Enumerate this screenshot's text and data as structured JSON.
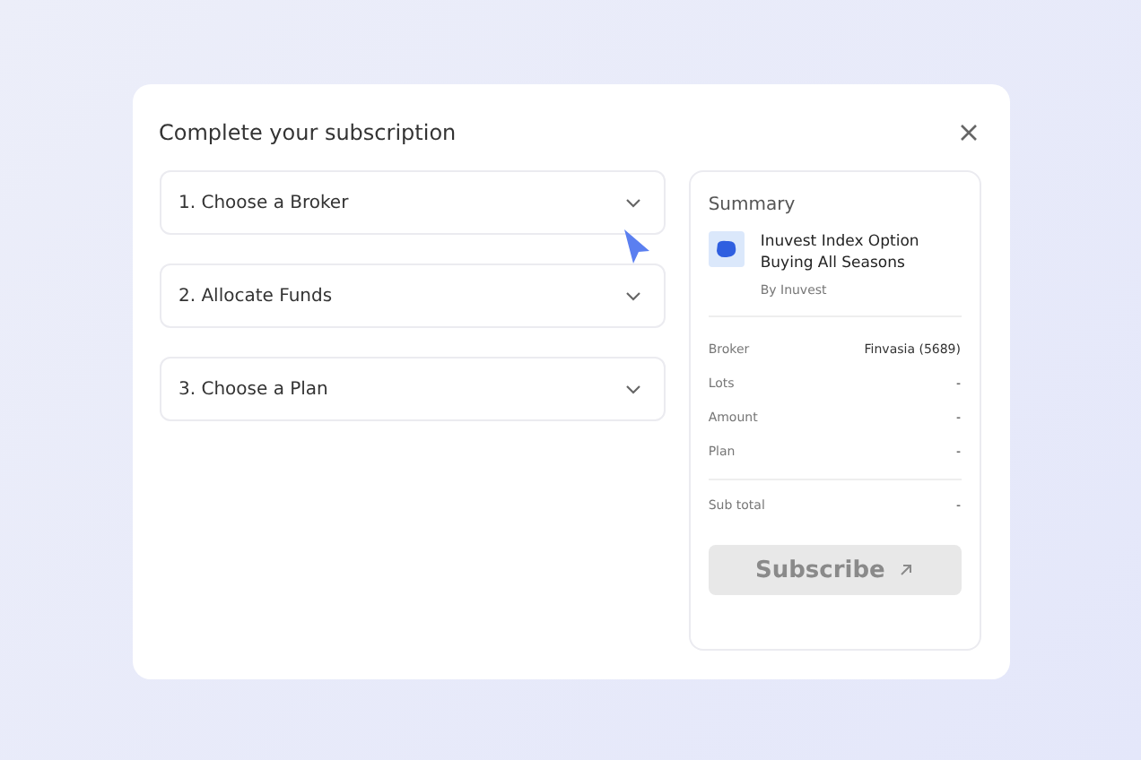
{
  "dialog": {
    "title": "Complete your subscription"
  },
  "steps": [
    {
      "label": "1. Choose a Broker",
      "expanded": false
    },
    {
      "label": "2. Allocate Funds",
      "expanded": false
    },
    {
      "label": "3. Choose a Plan",
      "expanded": false
    }
  ],
  "summary": {
    "heading": "Summary",
    "product": {
      "name": "Inuvest Index Option Buying All Seasons",
      "by": "By Inuvest"
    },
    "rows": [
      {
        "label": "Broker",
        "value": "Finvasia (5689)"
      },
      {
        "label": "Lots",
        "value": "-"
      },
      {
        "label": "Amount",
        "value": "-"
      },
      {
        "label": "Plan",
        "value": "-"
      }
    ],
    "subtotal": {
      "label": "Sub total",
      "value": "-"
    },
    "button": {
      "label": "Subscribe",
      "disabled": true
    }
  }
}
